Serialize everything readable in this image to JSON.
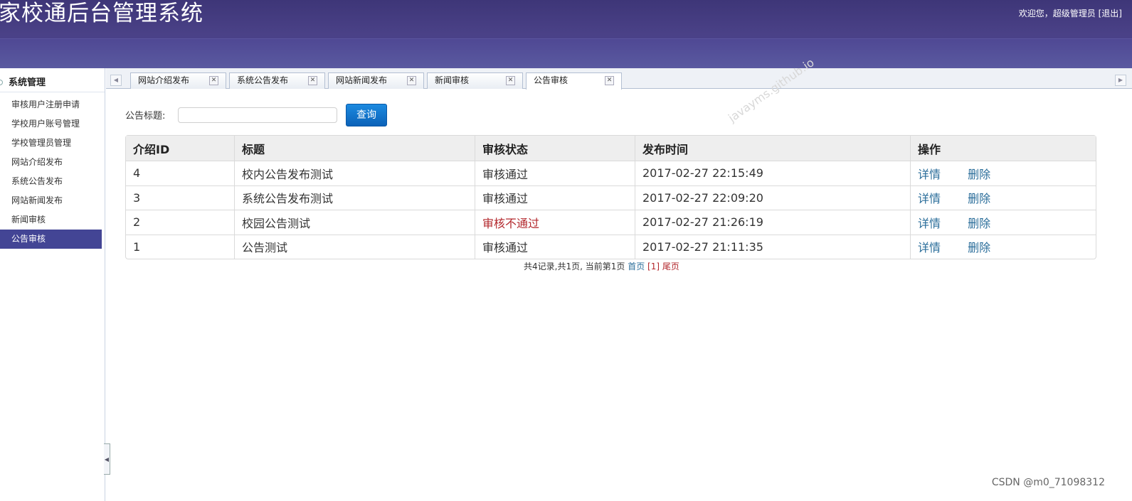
{
  "header": {
    "title": "家校通后台管理系统",
    "welcome": "欢迎您，超级管理员",
    "logout": "[退出]"
  },
  "sidebar": {
    "heading": "系统管理",
    "items": [
      {
        "label": "审核用户注册申请"
      },
      {
        "label": "学校用户账号管理"
      },
      {
        "label": "学校管理员管理"
      },
      {
        "label": "网站介绍发布"
      },
      {
        "label": "系统公告发布"
      },
      {
        "label": "网站新闻发布"
      },
      {
        "label": "新闻审核"
      },
      {
        "label": "公告审核",
        "active": true
      }
    ]
  },
  "tabs": [
    {
      "label": "网站介绍发布"
    },
    {
      "label": "系统公告发布"
    },
    {
      "label": "网站新闻发布"
    },
    {
      "label": "新闻审核"
    },
    {
      "label": "公告审核",
      "active": true
    }
  ],
  "search": {
    "label": "公告标题:",
    "value": "",
    "button": "查询"
  },
  "table": {
    "headers": [
      "介绍ID",
      "标题",
      "审核状态",
      "发布时间",
      "操作"
    ],
    "rows": [
      {
        "id": "4",
        "title": "校内公告发布测试",
        "status": "审核通过",
        "time": "2017-02-27 22:15:49",
        "detail": "详情",
        "delete": "删除"
      },
      {
        "id": "3",
        "title": "系统公告发布测试",
        "status": "审核通过",
        "time": "2017-02-27 22:09:20",
        "detail": "详情",
        "delete": "删除"
      },
      {
        "id": "2",
        "title": "校园公告测试",
        "status": "审核不通过",
        "time": "2017-02-27 21:26:19",
        "detail": "详情",
        "delete": "删除"
      },
      {
        "id": "1",
        "title": "公告测试",
        "status": "审核通过",
        "time": "2017-02-27 21:11:35",
        "detail": "详情",
        "delete": "删除"
      }
    ]
  },
  "pager": {
    "summary": "共4记录,共1页, 当前第1页",
    "first": "首页",
    "current": "[1]",
    "last": "尾页"
  },
  "watermark": "javayms.github.io",
  "credit": "CSDN @m0_71098312",
  "colors": {
    "header": "#4a4187",
    "active_sidebar": "#434595",
    "link": "#2a6d9a",
    "fail": "#b3282d",
    "button": "#0b62b8"
  }
}
